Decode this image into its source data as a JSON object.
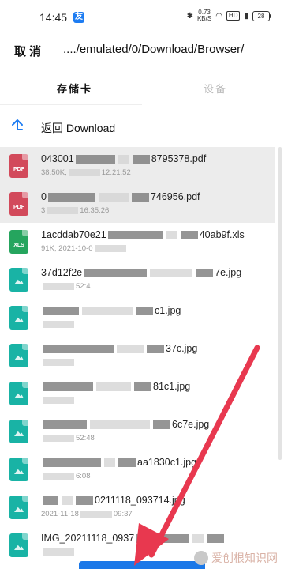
{
  "status_bar": {
    "time": "14:45",
    "app_badge": "友",
    "net_speed_value": "0.73",
    "net_speed_unit": "KB/S",
    "hd_tag": "HD",
    "battery": "28"
  },
  "header": {
    "cancel_label": "取 消",
    "path": "..../emulated/0/Download/Browser/"
  },
  "tabs": {
    "storage_label": "存储卡",
    "device_label": "设备"
  },
  "back_row": {
    "label": "返回 Download"
  },
  "files": [
    {
      "type": "PDF",
      "name_a": "043001",
      "name_b": "8795378.pdf",
      "meta_a": "38.50K,",
      "meta_b": "12:21:52",
      "selected": true
    },
    {
      "type": "PDF",
      "name_a": "0",
      "name_b": "746956.pdf",
      "meta_a": "3",
      "meta_b": "16:35:26",
      "selected": true
    },
    {
      "type": "XLS",
      "name_a": "1acddab70e21",
      "name_b": "40ab9f.xls",
      "meta_a": "91K, 2021-10-0",
      "meta_b": "",
      "selected": false
    },
    {
      "type": "IMG",
      "name_a": "37d12f2e",
      "name_b": "7e.jpg",
      "meta_a": "",
      "meta_b": "52:4",
      "selected": false
    },
    {
      "type": "IMG",
      "name_a": "",
      "name_b": "c1.jpg",
      "meta_a": "",
      "meta_b": "",
      "selected": false
    },
    {
      "type": "IMG",
      "name_a": "",
      "name_b": "37c.jpg",
      "meta_a": "",
      "meta_b": "",
      "selected": false
    },
    {
      "type": "IMG",
      "name_a": "",
      "name_b": "81c1.jpg",
      "meta_a": "",
      "meta_b": "",
      "selected": false
    },
    {
      "type": "IMG",
      "name_a": "",
      "name_b": "6c7e.jpg",
      "meta_a": "",
      "meta_b": "52:48",
      "selected": false
    },
    {
      "type": "IMG",
      "name_a": "",
      "name_b": "aa1830c1.jpg",
      "meta_a": "",
      "meta_b": "6:08",
      "selected": false
    },
    {
      "type": "IMG",
      "name_a": "",
      "name_b": "0211118_093714.jpg",
      "meta_a": "2021-11-18",
      "meta_b": "09:37",
      "selected": false
    },
    {
      "type": "IMG",
      "name_a": "IMG_20211118_0937",
      "name_b": "",
      "meta_a": "",
      "meta_b": "",
      "selected": false
    }
  ],
  "icon_colors": {
    "PDF": "#d24a5b",
    "XLS": "#25a55e",
    "IMG": "#19b3a5"
  },
  "watermark": "爱创根知识网",
  "arrow_color": "#e8384f"
}
